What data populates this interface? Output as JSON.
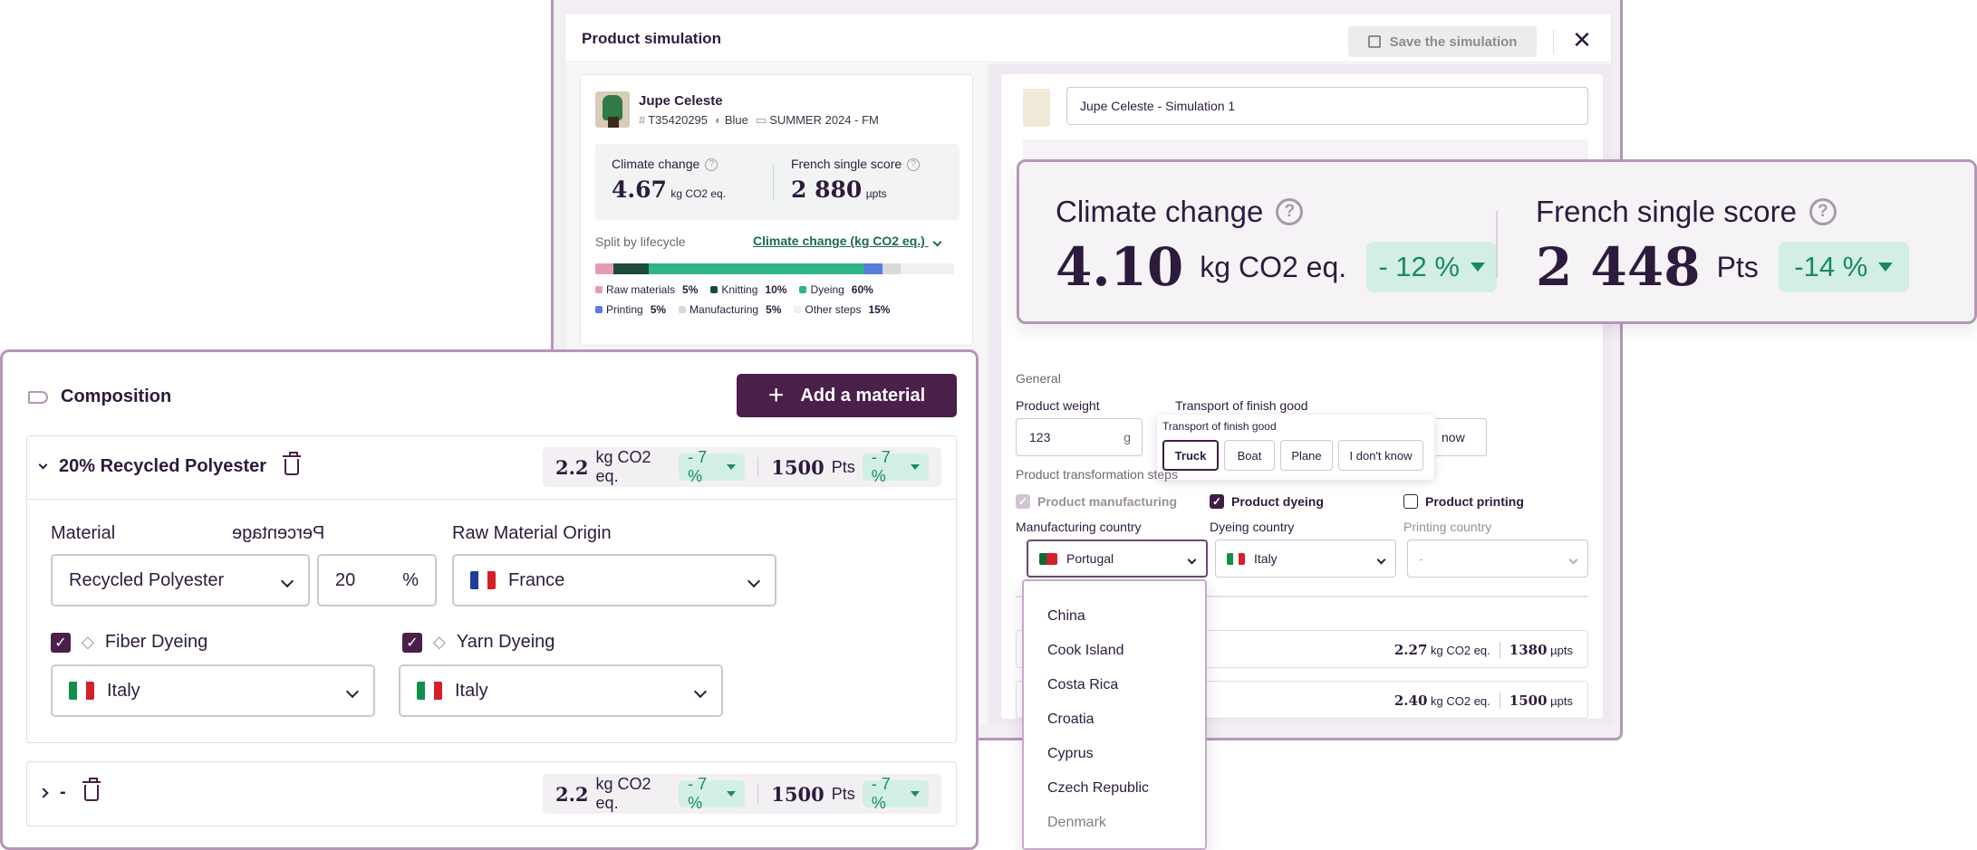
{
  "simulation": {
    "title": "Product simulation",
    "save_label": "Save the simulation",
    "close_icon": "close-icon",
    "product": {
      "name": "Jupe Celeste",
      "ref": "T35420295",
      "color": "Blue",
      "collection": "SUMMER 2024 - FM"
    },
    "scores": {
      "climate_label": "Climate change",
      "climate_value": "4.67",
      "climate_unit": "kg CO2 eq.",
      "french_label": "French single score",
      "french_value": "2 880",
      "french_unit": "µpts"
    },
    "split": {
      "label": "Split by lifecycle",
      "selector": "Climate change (kg CO2 eq.)",
      "segments": [
        {
          "name": "Raw materials",
          "pct": "5%",
          "share": 5,
          "color": "#e79ab5"
        },
        {
          "name": "Knitting",
          "pct": "10%",
          "share": 10,
          "color": "#1d4b3a"
        },
        {
          "name": "Dyeing",
          "pct": "60%",
          "share": 60,
          "color": "#2fb58a"
        },
        {
          "name": "Printing",
          "pct": "5%",
          "share": 5,
          "color": "#5b7be0"
        },
        {
          "name": "Manufacturing",
          "pct": "5%",
          "share": 5,
          "color": "#d9d9d9"
        },
        {
          "name": "Other steps",
          "pct": "15%",
          "share": 15,
          "color": "#f0f0f0"
        }
      ]
    },
    "sim_name_value": "Jupe Celeste - Simulation 1",
    "general_label": "General",
    "product_weight_label": "Product weight",
    "product_weight_value": "123",
    "product_weight_unit": "g",
    "transport_label": "Transport of finish good",
    "transport_popup_title": "Transport of finish good",
    "transport_options": [
      "Truck",
      "Boat",
      "Plane",
      "I don't know"
    ],
    "transport_selected": "Truck",
    "transport_fragment": "now",
    "transformation_label": "Product transformation steps",
    "steps": {
      "manufacturing": {
        "label": "Product manufacturing",
        "country_label": "Manufacturing country",
        "country": "Portugal"
      },
      "dyeing": {
        "label": "Product dyeing",
        "country_label": "Dyeing country",
        "country": "Italy"
      },
      "printing": {
        "label": "Product printing",
        "country_label": "Printing country",
        "country": "-"
      }
    },
    "sub_rows": [
      {
        "co2": "2.27",
        "co2_unit": "kg CO2 eq.",
        "pts": "1380",
        "pts_unit": "µpts"
      },
      {
        "co2": "2.40",
        "co2_unit": "kg CO2 eq.",
        "pts": "1500",
        "pts_unit": "µpts"
      }
    ]
  },
  "score_card": {
    "climate_label": "Climate change",
    "climate_value": "4.10",
    "climate_unit": "kg CO2 eq.",
    "climate_delta": "- 12 %",
    "french_label": "French single score",
    "french_value": "2 448",
    "french_unit": "Pts",
    "french_delta": "-14 %"
  },
  "country_dropdown": {
    "items": [
      "China",
      "Cook Island",
      "Costa Rica",
      "Croatia",
      "Cyprus",
      "Czech Republic",
      "Denmark"
    ]
  },
  "composition": {
    "title": "Composition",
    "add_label": "Add a material",
    "material1": {
      "title": "20% Recycled Polyester",
      "co2": "2.2",
      "co2_unit": "kg CO2 eq.",
      "co2_delta": "- 7 %",
      "pts": "1500",
      "pts_unit": "Pts",
      "pts_delta": "- 7 %",
      "material_label": "Material",
      "material_value": "Recycled Polyester",
      "percentage_label": "Percentage",
      "percentage_value": "20",
      "percentage_unit": "%",
      "origin_label": "Raw Material Origin",
      "origin_value": "France",
      "fiber_dyeing_label": "Fiber Dyeing",
      "fiber_dyeing_value": "Italy",
      "yarn_dyeing_label": "Yarn Dyeing",
      "yarn_dyeing_value": "Italy"
    },
    "material2": {
      "title": "-",
      "co2": "2.2",
      "co2_unit": "kg CO2 eq.",
      "co2_delta": "- 7 %",
      "pts": "1500",
      "pts_unit": "Pts",
      "pts_delta": "- 7 %"
    }
  },
  "colors": {
    "brand_purple": "#4a1f4a",
    "accent_border": "#b497b6",
    "positive_green": "#188a62",
    "positive_bg": "#d3efe4"
  }
}
